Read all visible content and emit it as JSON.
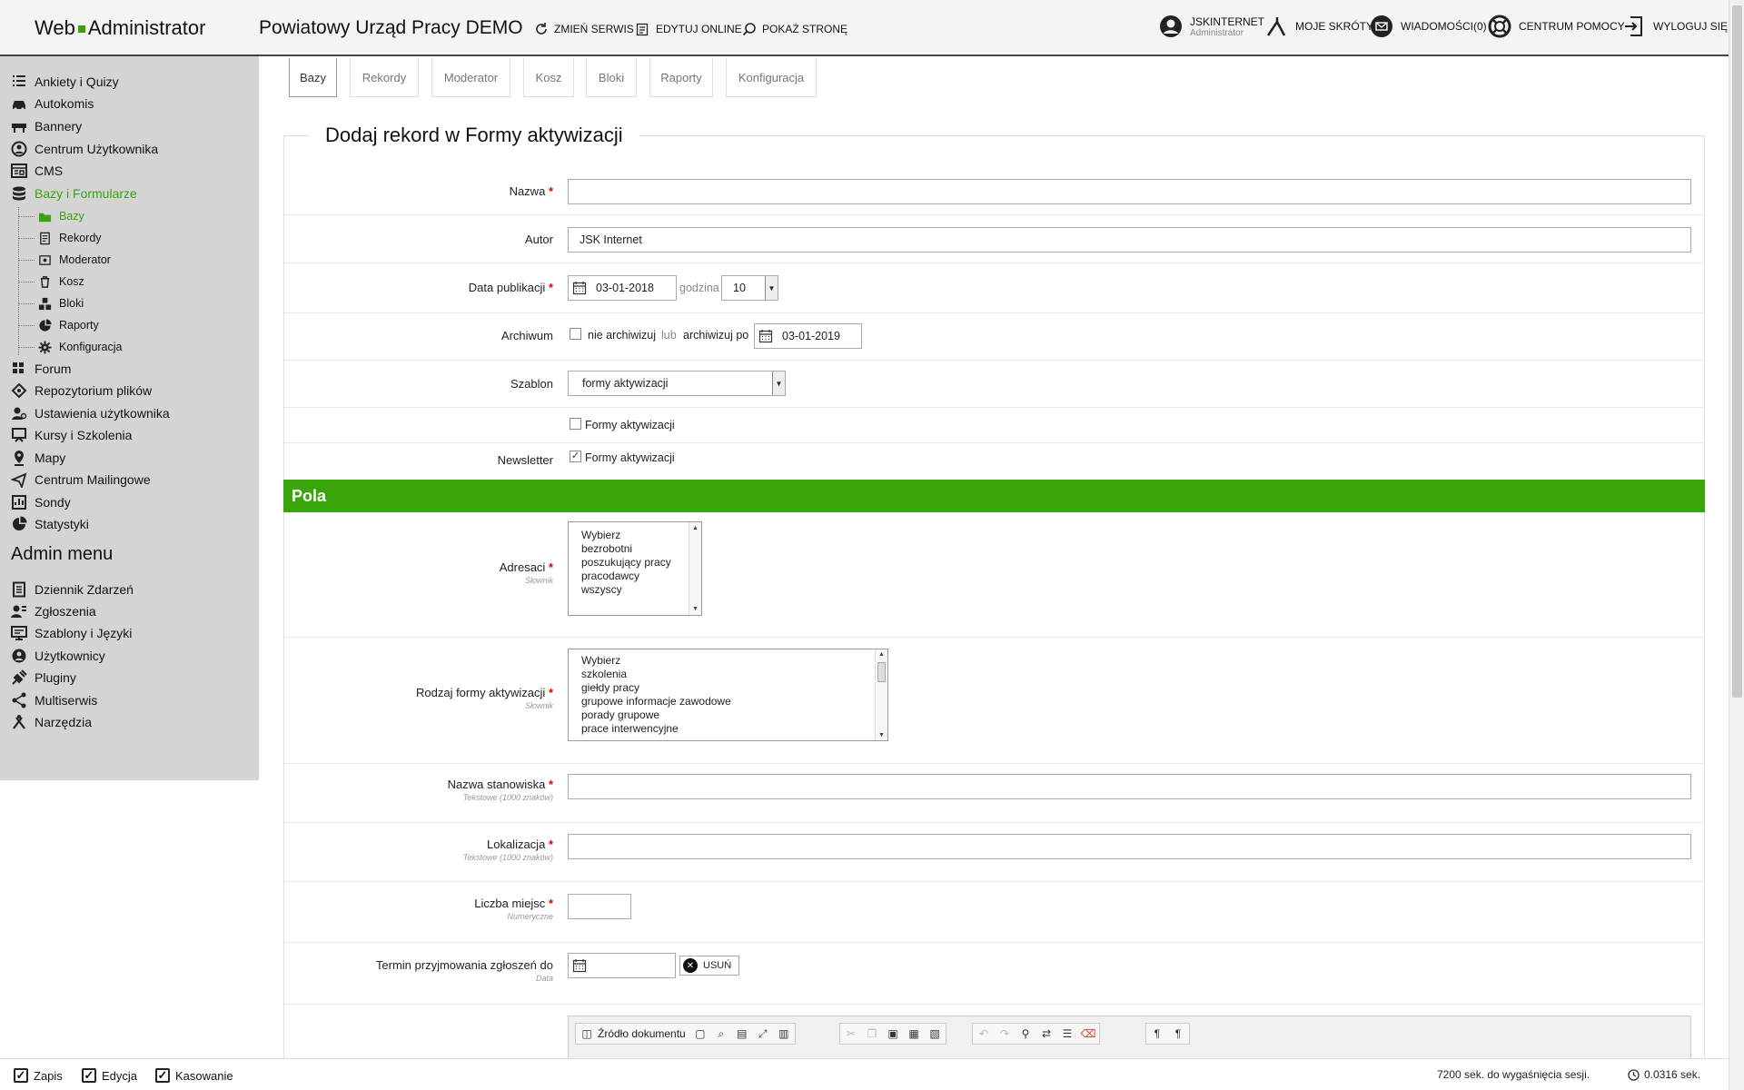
{
  "header": {
    "logo_web": "Web",
    "logo_admin": "Administrator",
    "site_title": "Powiatowy Urząd Pracy DEMO",
    "change_service": "ZMIEŃ SERWIS",
    "edit_online": "EDYTUJ ONLINE",
    "show_page": "POKAŻ STRONĘ",
    "user_name": "JSKINTERNET",
    "user_role": "Administrator",
    "shortcuts": "MOJE SKRÓTY",
    "messages": "WIADOMOŚCI(0)",
    "help": "CENTRUM POMOCY",
    "logout": "WYLOGUJ SIĘ"
  },
  "sidebar": {
    "items": [
      {
        "label": "Ankiety i Quizy",
        "icon": "survey-icon"
      },
      {
        "label": "Autokomis",
        "icon": "car-icon"
      },
      {
        "label": "Bannery",
        "icon": "banner-icon"
      },
      {
        "label": "Centrum Użytkownika",
        "icon": "user-center-icon"
      },
      {
        "label": "CMS",
        "icon": "cms-icon"
      },
      {
        "label": "Bazy i Formularze",
        "icon": "database-icon"
      }
    ],
    "subitems": [
      {
        "label": "Bazy",
        "icon": "folder-icon"
      },
      {
        "label": "Rekordy",
        "icon": "document-icon"
      },
      {
        "label": "Moderator",
        "icon": "moderator-icon"
      },
      {
        "label": "Kosz",
        "icon": "trash-icon"
      },
      {
        "label": "Bloki",
        "icon": "blocks-icon"
      },
      {
        "label": "Raporty",
        "icon": "pie-chart-icon"
      },
      {
        "label": "Konfiguracja",
        "icon": "gear-icon"
      }
    ],
    "items2": [
      {
        "label": "Forum",
        "icon": "forum-icon"
      },
      {
        "label": "Repozytorium plików",
        "icon": "files-icon"
      },
      {
        "label": "Ustawienia użytkownika",
        "icon": "user-settings-icon"
      },
      {
        "label": "Kursy i Szkolenia",
        "icon": "courses-icon"
      },
      {
        "label": "Mapy",
        "icon": "map-pin-icon"
      },
      {
        "label": "Centrum Mailingowe",
        "icon": "mailing-icon"
      },
      {
        "label": "Sondy",
        "icon": "poll-icon"
      },
      {
        "label": "Statystyki",
        "icon": "stats-icon"
      }
    ],
    "admin_title": "Admin menu",
    "admin_items": [
      {
        "label": "Dziennik Zdarzeń",
        "icon": "log-icon"
      },
      {
        "label": "Zgłoszenia",
        "icon": "reports-icon"
      },
      {
        "label": "Szablony i Języki",
        "icon": "templates-icon"
      },
      {
        "label": "Użytkownicy",
        "icon": "users-icon"
      },
      {
        "label": "Pluginy",
        "icon": "plugin-icon"
      },
      {
        "label": "Multiserwis",
        "icon": "multiservice-icon"
      },
      {
        "label": "Narzędzia",
        "icon": "tools-icon"
      }
    ]
  },
  "tabs": [
    "Bazy",
    "Rekordy",
    "Moderator",
    "Kosz",
    "Bloki",
    "Raporty",
    "Konfiguracja"
  ],
  "form": {
    "title": "Dodaj rekord w Formy aktywizacji",
    "nazwa_label": "Nazwa",
    "nazwa_value": "",
    "autor_label": "Autor",
    "autor_value": "JSK Internet",
    "data_label": "Data publikacji",
    "data_value": "03-01-2018",
    "godzina_label": "godzina",
    "godzina_value": "10",
    "archiwum_label": "Archiwum",
    "nie_archiwizuj": "nie archiwizuj",
    "lub": "lub",
    "archiwizuj_po": "archiwizuj po",
    "archiwum_date": "03-01-2019",
    "szablon_label": "Szablon",
    "szablon_value": "formy aktywizacji",
    "formy_checkbox": "Formy aktywizacji",
    "newsletter_label": "Newsletter",
    "newsletter_checkbox": "Formy aktywizacji",
    "pola_title": "Pola",
    "adresaci_label": "Adresaci",
    "adresaci_hint": "Słownik",
    "adresaci_options": [
      "Wybierz",
      "bezrobotni",
      "poszukujący pracy",
      "pracodawcy",
      "wszyscy"
    ],
    "rodzaj_label": "Rodzaj formy aktywizacji",
    "rodzaj_hint": "Słownik",
    "rodzaj_options": [
      "Wybierz",
      "szkolenia",
      "giełdy pracy",
      "grupowe informacje zawodowe",
      "porady grupowe",
      "prace interwencyjne"
    ],
    "stanowisko_label": "Nazwa stanowiska",
    "stanowisko_hint": "Tekstowe (1000 znaków)",
    "lokalizacja_label": "Lokalizacja",
    "lokalizacja_hint": "Tekstowe (1000 znaków)",
    "miejsca_label": "Liczba miejsc",
    "miejsca_hint": "Numeryczne",
    "termin_label": "Termin przyjmowania zgłoszeń do",
    "termin_hint": "Data",
    "usun_label": "USUŃ",
    "editor_source": "Źródło dokumentu"
  },
  "bottom": {
    "zapis": "Zapis",
    "edycja": "Edycja",
    "kasowanie": "Kasowanie",
    "session": "7200 sek. do wygaśnięcia sesji.",
    "timing": "0.0316 sek."
  },
  "colors": {
    "accent": "#3aa40b",
    "required": "#dd0000"
  }
}
